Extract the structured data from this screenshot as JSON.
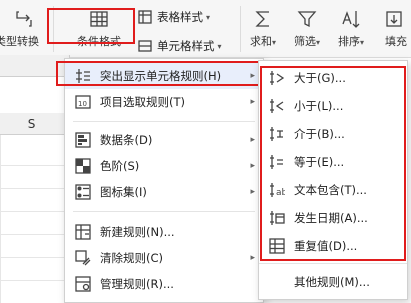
{
  "ribbon": {
    "type_convert": "类型转换",
    "conditional_format": "条件格式",
    "table_style": "表格样式",
    "cell_style": "单元格样式",
    "sum": "求和",
    "filter": "筛选",
    "sort": "排序",
    "fill": "填充"
  },
  "sheet": {
    "column_label": "S"
  },
  "main_menu": {
    "items": [
      {
        "label": "突出显示单元格规则(H)",
        "icon": "highlight-rules-icon"
      },
      {
        "label": "项目选取规则(T)",
        "icon": "top-bottom-rules-icon"
      },
      {
        "label": "数据条(D)",
        "icon": "data-bars-icon"
      },
      {
        "label": "色阶(S)",
        "icon": "color-scale-icon"
      },
      {
        "label": "图标集(I)",
        "icon": "icon-sets-icon"
      },
      {
        "label": "新建规则(N)...",
        "icon": "new-rule-icon"
      },
      {
        "label": "清除规则(C)",
        "icon": "clear-rules-icon"
      },
      {
        "label": "管理规则(R)...",
        "icon": "manage-rules-icon"
      }
    ]
  },
  "sub_menu": {
    "items": [
      {
        "label": "大于(G)...",
        "icon": "greater-than-icon"
      },
      {
        "label": "小于(L)...",
        "icon": "less-than-icon"
      },
      {
        "label": "介于(B)...",
        "icon": "between-icon"
      },
      {
        "label": "等于(E)...",
        "icon": "equal-to-icon"
      },
      {
        "label": "文本包含(T)...",
        "icon": "text-contains-icon"
      },
      {
        "label": "发生日期(A)...",
        "icon": "date-occurring-icon"
      },
      {
        "label": "重复值(D)...",
        "icon": "duplicate-values-icon"
      }
    ],
    "other_rules": "其他规则(M)..."
  },
  "colors": {
    "highlight_red": "#e01c1c",
    "menu_hover": "#e8eefb"
  }
}
